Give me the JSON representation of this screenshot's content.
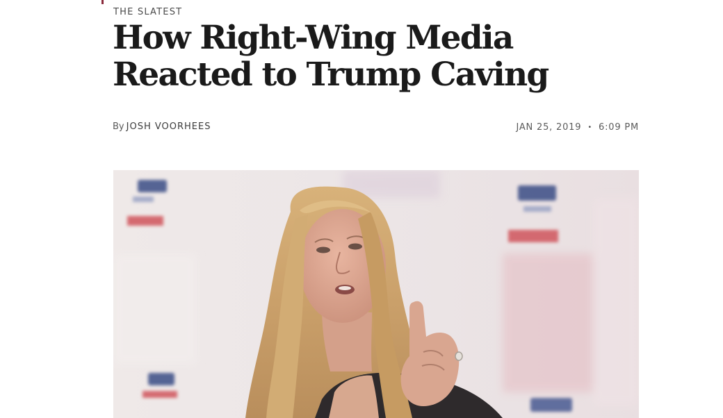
{
  "section": {
    "kicker": "THE SLATEST",
    "accent_color": "#8b2b3d"
  },
  "article": {
    "headline": "How Right-Wing Media Reacted to Trump Caving",
    "byline_prefix": "By",
    "author": "JOSH VOORHEES",
    "date": "JAN 25, 2019",
    "separator": "•",
    "time": "6:09 PM"
  },
  "lead_image": {
    "description": "Photo of a woman with long blonde hair speaking and gesturing with a raised finger in front of a red, white and blue logo backdrop"
  }
}
